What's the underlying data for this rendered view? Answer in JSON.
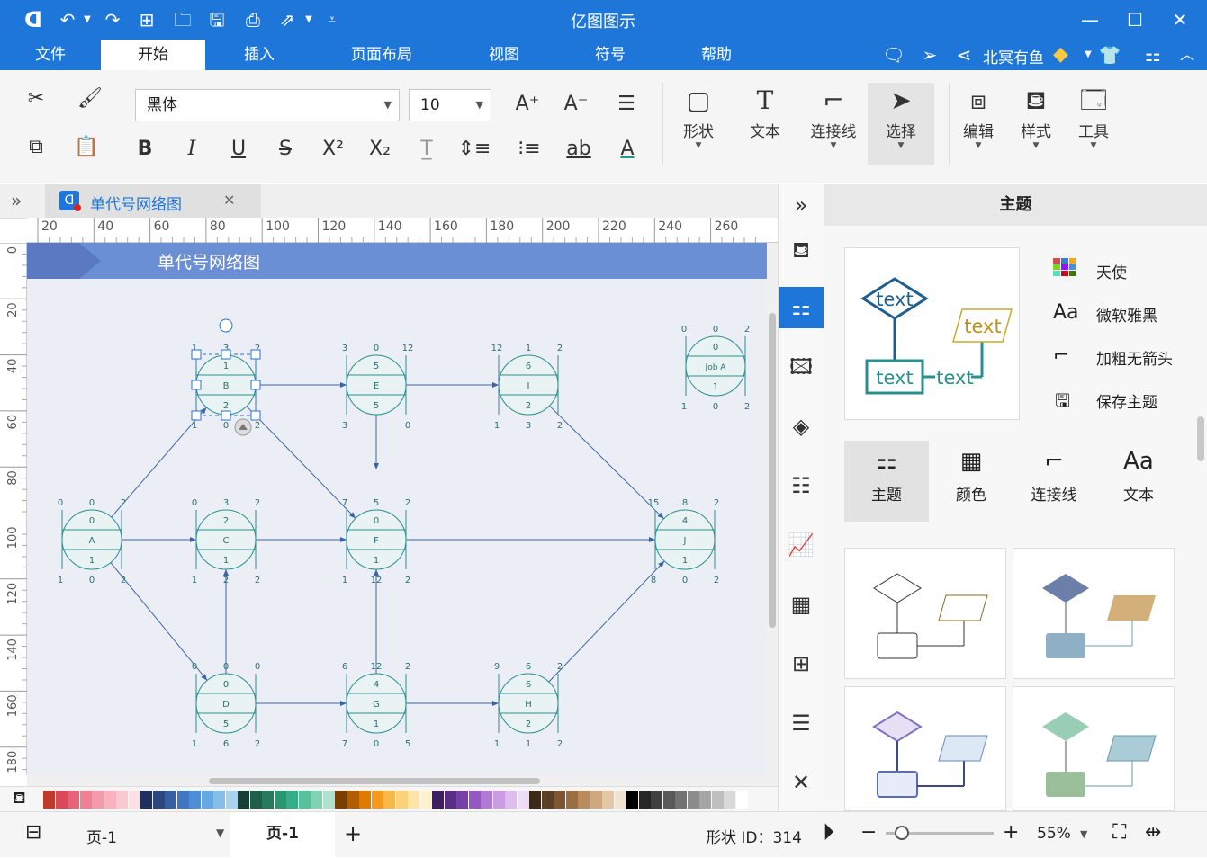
{
  "app": {
    "title": "亿图图示"
  },
  "menu": {
    "items": [
      "文件",
      "开始",
      "插入",
      "页面布局",
      "视图",
      "符号",
      "帮助"
    ],
    "active": "开始"
  },
  "user": {
    "name": "北冥有鱼"
  },
  "ribbon": {
    "font_family": "黑体",
    "font_size": "10",
    "big_buttons": [
      {
        "label": "形状"
      },
      {
        "label": "文本"
      },
      {
        "label": "连接线"
      },
      {
        "label": "选择"
      }
    ],
    "right_buttons": [
      {
        "label": "编辑"
      },
      {
        "label": "样式"
      },
      {
        "label": "工具"
      }
    ]
  },
  "document": {
    "tab_title": "单代号网络图",
    "diagram_title": "单代号网络图"
  },
  "ruler": {
    "h_ticks": [
      "20",
      "40",
      "60",
      "80",
      "100",
      "120",
      "140",
      "160",
      "180",
      "200",
      "220",
      "240",
      "260"
    ],
    "v_ticks": [
      "0",
      "20",
      "40",
      "60",
      "80",
      "100",
      "120",
      "140",
      "160",
      "180"
    ]
  },
  "diagram": {
    "nodes": [
      {
        "id": "A",
        "tl": "0",
        "tc": "0",
        "tr": "2",
        "top": "0",
        "bottom": "1",
        "bl": "1",
        "bc": "0",
        "br": "2"
      },
      {
        "id": "B",
        "tl": "1",
        "tc": "3",
        "tr": "2",
        "top": "1",
        "bottom": "2",
        "bl": "1",
        "bc": "0",
        "br": "2"
      },
      {
        "id": "C",
        "tl": "0",
        "tc": "3",
        "tr": "2",
        "top": "2",
        "bottom": "1",
        "bl": "1",
        "bc": "2",
        "br": "2"
      },
      {
        "id": "D",
        "tl": "0",
        "tc": "0",
        "tr": "0",
        "top": "0",
        "bottom": "5",
        "bl": "1",
        "bc": "6",
        "br": "2"
      },
      {
        "id": "E",
        "tl": "3",
        "tc": "0",
        "tr": "12",
        "top": "5",
        "bottom": "5",
        "bl": "3",
        "bc": "",
        "br": "0"
      },
      {
        "id": "F",
        "tl": "7",
        "tc": "5",
        "tr": "2",
        "top": "0",
        "bottom": "1",
        "bl": "1",
        "bc": "12",
        "br": "2"
      },
      {
        "id": "G",
        "tl": "6",
        "tc": "12",
        "tr": "2",
        "top": "4",
        "bottom": "1",
        "bl": "7",
        "bc": "0",
        "br": "5"
      },
      {
        "id": "I",
        "tl": "12",
        "tc": "1",
        "tr": "2",
        "top": "6",
        "bottom": "2",
        "bl": "1",
        "bc": "3",
        "br": "2"
      },
      {
        "id": "H",
        "tl": "9",
        "tc": "6",
        "tr": "2",
        "top": "6",
        "bottom": "2",
        "bl": "1",
        "bc": "1",
        "br": "2"
      },
      {
        "id": "J",
        "tl": "15",
        "tc": "8",
        "tr": "2",
        "top": "4",
        "bottom": "1",
        "bl": "8",
        "bc": "0",
        "br": "2"
      },
      {
        "id": "Job A",
        "tl": "0",
        "tc": "0",
        "tr": "2",
        "top": "0",
        "bottom": "1",
        "bl": "1",
        "bc": "0",
        "br": "2"
      }
    ]
  },
  "sidebar": {
    "icons": [
      "expand-icon",
      "fill-icon",
      "theme-icon",
      "image-icon",
      "layers-icon",
      "page-icon",
      "chart-icon",
      "table-icon",
      "org-icon",
      "gantt-icon",
      "mindmap-icon"
    ]
  },
  "panel": {
    "title": "主题",
    "preview_texts": [
      "text",
      "text",
      "text",
      "text"
    ],
    "options": [
      "天使",
      "微软雅黑",
      "加粗无箭头",
      "保存主题"
    ],
    "tools": [
      "主题",
      "颜色",
      "连接线",
      "文本"
    ],
    "active_tool": "主题"
  },
  "status": {
    "page_select": "页-1",
    "page_tab": "页-1",
    "shape_id": "形状 ID：314",
    "zoom": "55%"
  },
  "colors": {
    "primary": "#1f76d9",
    "node": "#2a8f8f",
    "edge": "#3a64a8",
    "title_bar": "#6b8fd4"
  },
  "palette": [
    "#c0392b",
    "#d94b5b",
    "#e8637a",
    "#f07f93",
    "#f59aaa",
    "#f8b3bf",
    "#fbc8cf",
    "#fde0e4",
    "#1f2f5f",
    "#2c4680",
    "#355fa3",
    "#3f77c0",
    "#4c8fd6",
    "#66a8e2",
    "#86bde9",
    "#a9d2f0",
    "#173f35",
    "#1e5f4a",
    "#237a5c",
    "#2a9570",
    "#35ae85",
    "#58c19c",
    "#80d2b5",
    "#aee3cf",
    "#7a3e00",
    "#b35c00",
    "#e07b00",
    "#f59a1b",
    "#f8b84a",
    "#fbd27a",
    "#fde5a8",
    "#fff2cc",
    "#3e1f5f",
    "#5a2d86",
    "#7740a8",
    "#9659c4",
    "#b17ad6",
    "#c99be3",
    "#ddbcee",
    "#efdcf7",
    "#3b2a1a",
    "#5c3f26",
    "#7d5634",
    "#9c6e44",
    "#b98b5e",
    "#d0a87f",
    "#e3c7a6",
    "#f2e3d0",
    "#000000",
    "#262626",
    "#404040",
    "#595959",
    "#737373",
    "#8c8c8c",
    "#a6a6a6",
    "#bfbfbf",
    "#d9d9d9",
    "#ffffff"
  ]
}
